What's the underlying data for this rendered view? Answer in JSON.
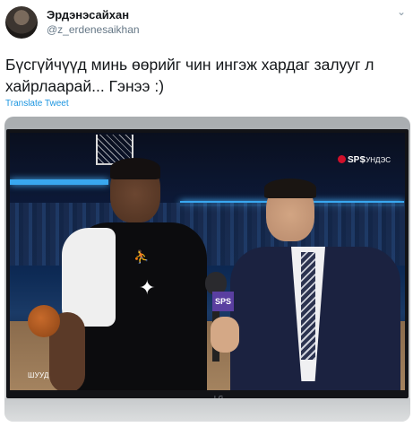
{
  "tweet": {
    "display_name": "Эрдэнэсайхан",
    "handle": "@z_erdenesaikhan",
    "chevron_glyph": "⌄",
    "text": "Бүсгүйчүүд минь өөрийг чин ингэж хардаг залууг л хайрлаарай... Гэнээ :)",
    "translate_label": "Translate Tweet",
    "link_color": "#1b95e0"
  },
  "media": {
    "broadcaster_logo": "SPS",
    "broadcaster_sub": "| УНДЭС",
    "live_caption": "ШУУД",
    "mic_flag_text": "SPS",
    "tv_brand": "LG"
  }
}
